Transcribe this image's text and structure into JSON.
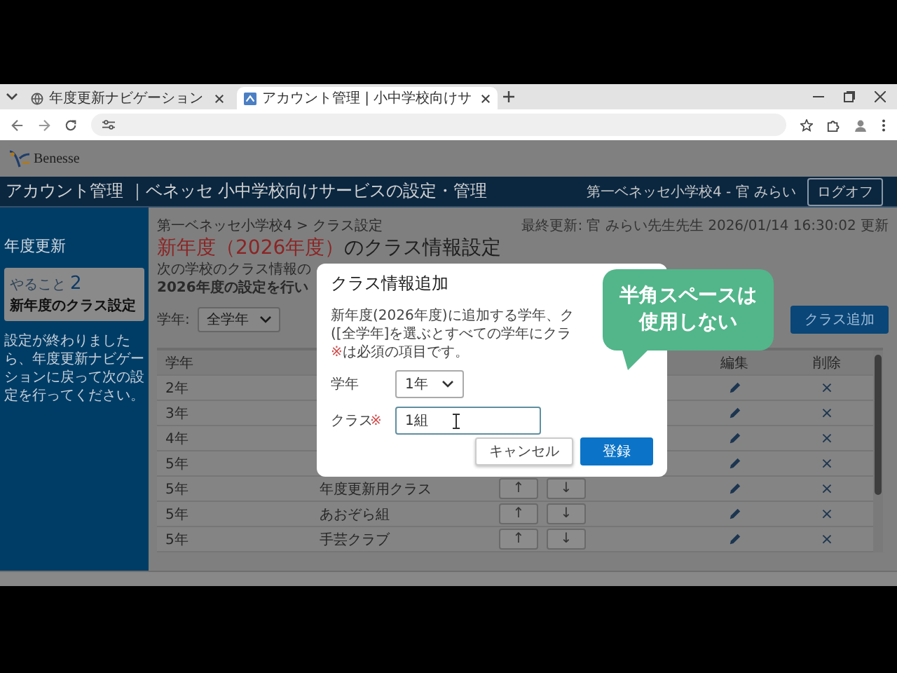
{
  "browser": {
    "tabs": [
      {
        "title": "年度更新ナビゲーション",
        "selected": false
      },
      {
        "title": "アカウント管理 | 小中学校向けサ",
        "selected": true
      }
    ]
  },
  "app_header": {
    "logo_text": "Benesse"
  },
  "title_bar": {
    "title": "アカウント管理 ｜ベネッセ 小中学校向けサービスの設定・管理",
    "user": "第一ベネッセ小学校4 - 官 みらい",
    "logout_button": "ログオフ"
  },
  "sidebar": {
    "heading": "年度更新",
    "task": {
      "label": "やること",
      "number": "2",
      "title": "新年度のクラス設定"
    },
    "note": "設定が終わりましたら、年度更新ナビゲーションに戻って次の設定を行ってください。"
  },
  "main": {
    "breadcrumb": "第一ベネッセ小学校4 > クラス設定",
    "last_updated": "最終更新: 官 みらい先生先生 2026/01/14 16:30:02 更新",
    "title": {
      "highlight": "新年度（2026年度）",
      "rest": "のクラス情報設定"
    },
    "intro": "次の学校のクラス情報の",
    "notice": "2026年度の設定を行い",
    "filter": {
      "label": "学年:",
      "value": "全学年"
    },
    "add_button": "クラス追加"
  },
  "table": {
    "columns": {
      "grade": "学年",
      "edit": "編集",
      "delete": "削除"
    },
    "rows": [
      {
        "grade": "2年",
        "delete": "×"
      },
      {
        "grade": "3年",
        "delete": "×"
      },
      {
        "grade": "4年",
        "delete": "×"
      },
      {
        "grade": "5年",
        "delete": "×"
      },
      {
        "grade": "5年",
        "class": "年度更新用クラス",
        "up": "↑",
        "down": "↓",
        "delete": "×"
      },
      {
        "grade": "5年",
        "class": "あおぞら組",
        "up": "↑",
        "down": "↓",
        "delete": "×"
      },
      {
        "grade": "5年",
        "class": "手芸クラブ",
        "up": "↑",
        "down": "↓",
        "delete": "×"
      }
    ]
  },
  "modal": {
    "title": "クラス情報追加",
    "description": [
      "新年度(2026年度)に追加する学年、ク",
      "([全学年]を選ぶとすべての学年にクラ"
    ],
    "required_note": {
      "mark": "※",
      "text": "は必須の項目です。"
    },
    "fields": [
      {
        "kind": "select",
        "label": "学年",
        "value": "1年"
      },
      {
        "kind": "text",
        "label": "クラス",
        "required_mark": "※",
        "value": "1組"
      }
    ],
    "buttons": [
      {
        "kind": "secondary",
        "label": "キャンセル"
      },
      {
        "kind": "primary",
        "label": "登録"
      }
    ]
  },
  "callout": {
    "lines": [
      "半角スペースは",
      "使用しない"
    ]
  }
}
